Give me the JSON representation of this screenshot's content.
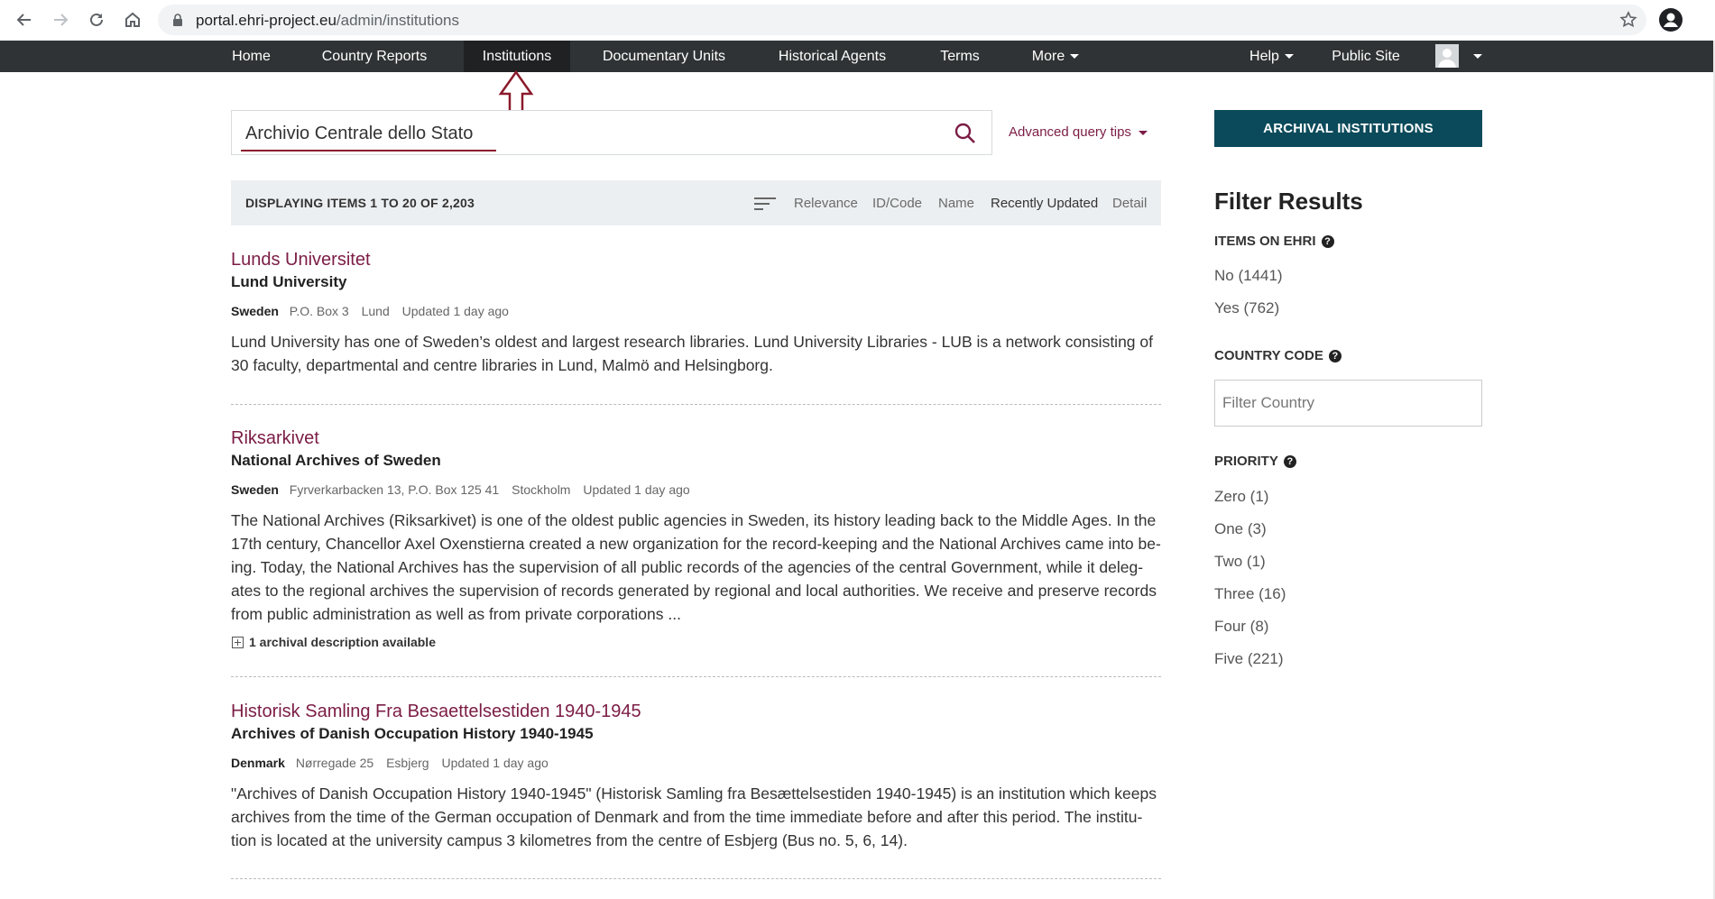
{
  "browser": {
    "url_host": "portal.ehri-project.eu",
    "url_path": "/admin/institutions"
  },
  "nav": {
    "items": [
      {
        "label": "Home"
      },
      {
        "label": "Country Reports"
      },
      {
        "label": "Institutions"
      },
      {
        "label": "Documentary Units"
      },
      {
        "label": "Historical Agents"
      },
      {
        "label": "Terms"
      },
      {
        "label": "More"
      }
    ],
    "active": "Institutions",
    "help_label": "Help",
    "public_site_label": "Public Site"
  },
  "search": {
    "value": "Archivio Centrale dello Stato",
    "advanced_tips_label": "Advanced query tips"
  },
  "results_bar": {
    "count_label": "DISPLAYING ITEMS 1 TO 20 OF 2,203",
    "sort_options": [
      "Relevance",
      "ID/Code",
      "Name",
      "Recently Updated",
      "Detail"
    ],
    "current_sort": "Recently Updated"
  },
  "results": [
    {
      "title": "Lunds Universitet",
      "subtitle": "Lund University",
      "country": "Sweden",
      "address": "P.O. Box 3",
      "city": "Lund",
      "updated": "Updated 1 day ago",
      "description": "Lund University has one of Sweden’s oldest and largest research libraries. Lund University Libraries - LUB is a network consisting of 30 faculty, departmental and centre libraries in Lund, Malmö and Helsingborg."
    },
    {
      "title": "Riksarkivet",
      "subtitle": "National Archives of Sweden",
      "country": "Sweden",
      "address": "Fyrverkarbacken 13, P.O. Box 125 41",
      "city": "Stockholm",
      "updated": "Updated 1 day ago",
      "description": "The National Archives (Riksarkivet) is one of the oldest public agencies in Sweden, its history leading back to the Middle Ages. In the 17th century, Chancellor Axel Oxenstierna created a new organization for the record-keeping and the National Archives came into be­ing. Today, the National Archives has the supervision of all public records of the agencies of the central Government, while it deleg­ates to the regional archives the supervision of records generated by regional and local authorities. We receive and preserve records from public administration as well as from private corporations ...",
      "extra": "1 archival description available"
    },
    {
      "title": "Historisk Samling Fra Besaettelsestiden 1940-1945",
      "subtitle": "Archives of Danish Occupation History 1940-1945",
      "country": "Denmark",
      "address": "Nørregade 25",
      "city": "Esbjerg",
      "updated": "Updated 1 day ago",
      "description": "\"Archives of Danish Occupation History 1940-1945\" (Historisk Samling fra Besættelsestiden 1940-1945) is an institution which keeps archives from the time of the German occupation of Denmark and from the time immediate before and after this period. The institu­tion is located at the university campus 3 kilometres from the centre of Esbjerg (Bus no. 5, 6, 14)."
    }
  ],
  "sidebar": {
    "archival_button": "ARCHIVAL INSTITUTIONS",
    "filter_title": "Filter Results",
    "items_on_ehri": {
      "heading": "ITEMS ON EHRI",
      "options": [
        "No (1441)",
        "Yes (762)"
      ]
    },
    "country_code": {
      "heading": "COUNTRY CODE",
      "placeholder": "Filter Country"
    },
    "priority": {
      "heading": "PRIORITY",
      "options": [
        "Zero (1)",
        "One (3)",
        "Two (1)",
        "Three (16)",
        "Four (8)",
        "Five (221)"
      ]
    }
  },
  "colors": {
    "nav_bg": "#303335",
    "link": "#7b1c45",
    "accent_button": "#0b4a5a",
    "annotation": "#8b1a2c"
  }
}
